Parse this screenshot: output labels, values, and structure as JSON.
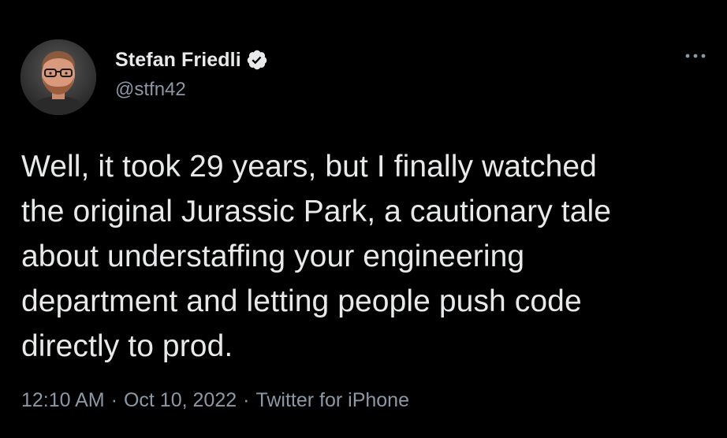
{
  "tweet": {
    "author": {
      "display_name": "Stefan Friedli",
      "handle": "@stfn42",
      "verified_icon": "verified-badge-icon"
    },
    "more_icon": "more-options-icon",
    "text": "Well, it took 29 years, but I finally watched\nthe original Jurassic Park, a cautionary tale\nabout understaffing your engineering\ndepartment and letting people push code\ndirectly to prod.",
    "time": "12:10 AM",
    "separator": "·",
    "date": "Oct 10, 2022",
    "source": "Twitter for iPhone"
  },
  "colors": {
    "background": "#000000",
    "primary_text": "#e7e9ea",
    "secondary_text": "#8b98a5",
    "verified_badge": "#e7e9ea"
  }
}
